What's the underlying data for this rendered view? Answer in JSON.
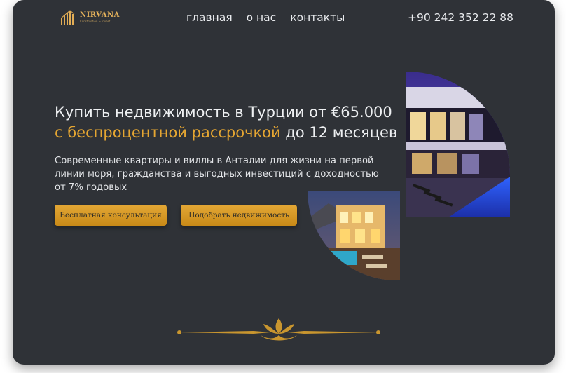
{
  "header": {
    "logo": {
      "name": "NIRVANA",
      "tagline": "Construction & Invest"
    },
    "nav": [
      {
        "label": "главная"
      },
      {
        "label": "о нас"
      },
      {
        "label": "контакты"
      }
    ],
    "phone": "+90 242 352 22 88"
  },
  "hero": {
    "title_part1": "Купить недвижимость в Турции от €65.000",
    "title_accent": "с беспроцентной рассрочкой",
    "title_part2": " до 12 месяцев",
    "subtitle": "Современные квартиры и виллы в Анталии для жизни на первой линии моря, гражданства и выгодных инвестиций с доходностью от 7% годовых",
    "buttons": {
      "consult": "Бесплатная консультация",
      "select": "Подобрать недвижимость"
    }
  },
  "colors": {
    "background": "#2f3237",
    "accent": "#e5a632",
    "text": "#eef0f2"
  },
  "icons": [
    "logo-building-icon",
    "ornament-divider-icon"
  ]
}
